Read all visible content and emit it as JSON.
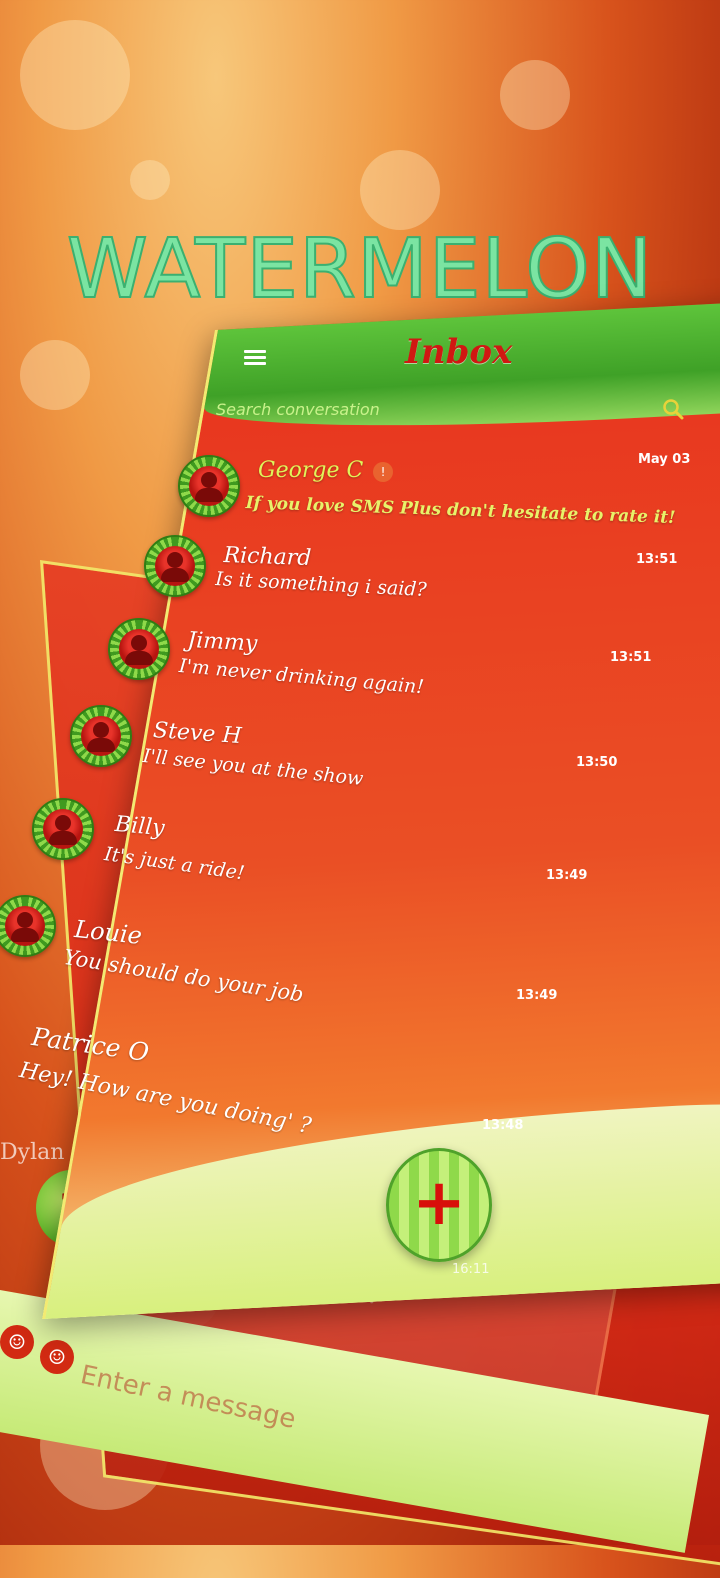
{
  "hero": {
    "title": "WATERMELON"
  },
  "header": {
    "title": "Inbox",
    "search_placeholder": "Search conversation"
  },
  "conversations": [
    {
      "name": "George C",
      "preview": "If you love SMS Plus don't hesitate to rate it!",
      "time": "May 03",
      "unread": "!"
    },
    {
      "name": "Richard",
      "preview": "Is it something i said?",
      "time": "13:51"
    },
    {
      "name": "Jimmy",
      "preview": "I'm never drinking again!",
      "time": "13:51"
    },
    {
      "name": "Steve H",
      "preview": "I'll see you at the show",
      "time": "13:50"
    },
    {
      "name": "Billy",
      "preview": "It's just a ride!",
      "time": "13:49"
    },
    {
      "name": "Louie",
      "preview": "You should do your job",
      "time": "13:49"
    },
    {
      "name": "Patrice O",
      "preview": "Hey! How are you doing' ?",
      "time": "13:48"
    }
  ],
  "fab": {
    "symbol": "+",
    "time": "16:11"
  },
  "back_screen": {
    "name": "Dylan",
    "message": "If you love SMS Plus don't hesitate to rate it!",
    "input_placeholder": "Enter a message",
    "question": "?"
  },
  "colors": {
    "accent_green": "#5ec43b",
    "accent_red": "#d01812",
    "title_green": "#7be4a2"
  }
}
